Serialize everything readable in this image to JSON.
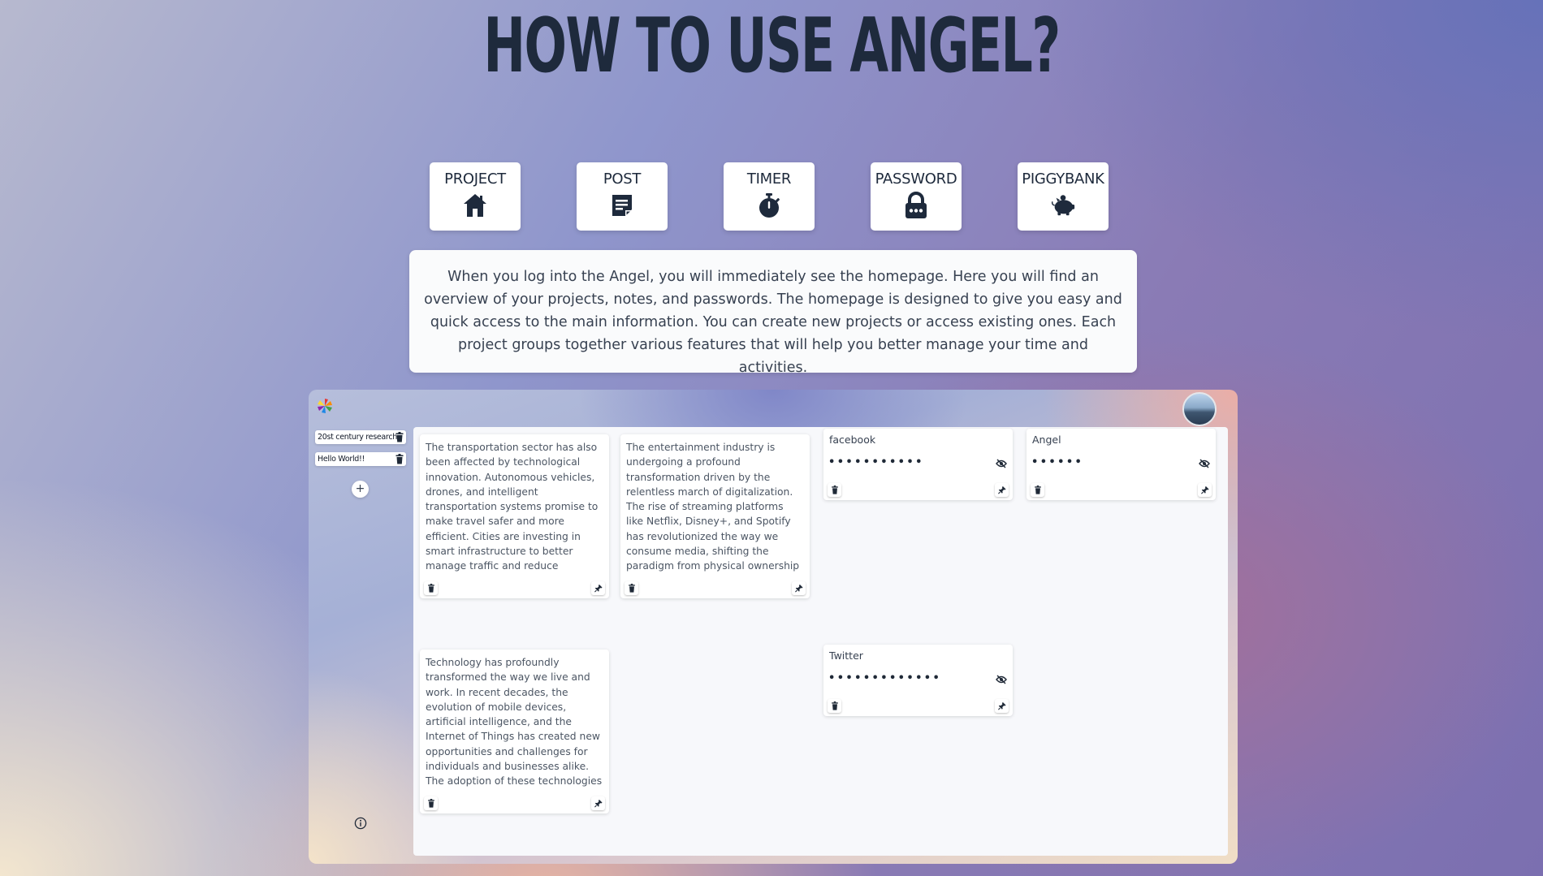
{
  "page": {
    "title": "HOW TO USE ANGEL?"
  },
  "features": [
    {
      "label": "PROJECT",
      "icon": "house-icon"
    },
    {
      "label": "POST",
      "icon": "note-icon"
    },
    {
      "label": "TIMER",
      "icon": "stopwatch-icon"
    },
    {
      "label": "PASSWORD",
      "icon": "lock-icon"
    },
    {
      "label": "PIGGYBANK",
      "icon": "piggybank-icon"
    }
  ],
  "description": "When you log into the Angel, you will immediately see the homepage. Here you will find an overview of your projects, notes, and passwords. The homepage is designed to give you easy and quick access to the main information. You can create new projects or access existing ones. Each project groups together various features that will help you better manage your time and activities.",
  "app": {
    "projects": [
      {
        "label": "20st century research"
      },
      {
        "label": "Hello World!!"
      }
    ],
    "add_label": "+",
    "notes": [
      {
        "text": "The transportation sector has also been affected by technological innovation. Autonomous vehicles, drones, and intelligent transportation systems promise to make travel safer and more efficient. Cities are investing in smart infrastructure to better manage traffic and reduce pollution. However, the adoption of these technologies also requires careful"
      },
      {
        "text": "The entertainment industry is undergoing a profound transformation driven by the relentless march of digitalization. The rise of streaming platforms like Netflix, Disney+, and Spotify has revolutionized the way we consume media, shifting the paradigm from physical ownership (DVDs, CDs) to on-demand access, available anywhere, anytime"
      },
      {
        "text": "Technology has profoundly transformed the way we live and work. In recent decades, the evolution of mobile devices, artificial intelligence, and the Internet of Things has created new opportunities and challenges for individuals and businesses alike. The adoption of these technologies has enhanced efficiency and productivity, enabling people to connect and"
      }
    ],
    "passwords": [
      {
        "name": "facebook",
        "masked": "•••••••••••"
      },
      {
        "name": "Angel",
        "masked": "••••••"
      },
      {
        "name": "Twitter",
        "masked": "•••••••••••••"
      }
    ]
  },
  "colors": {
    "ink": "#1e2a3c",
    "card": "#ffffff",
    "board": "#f7f8fb"
  }
}
